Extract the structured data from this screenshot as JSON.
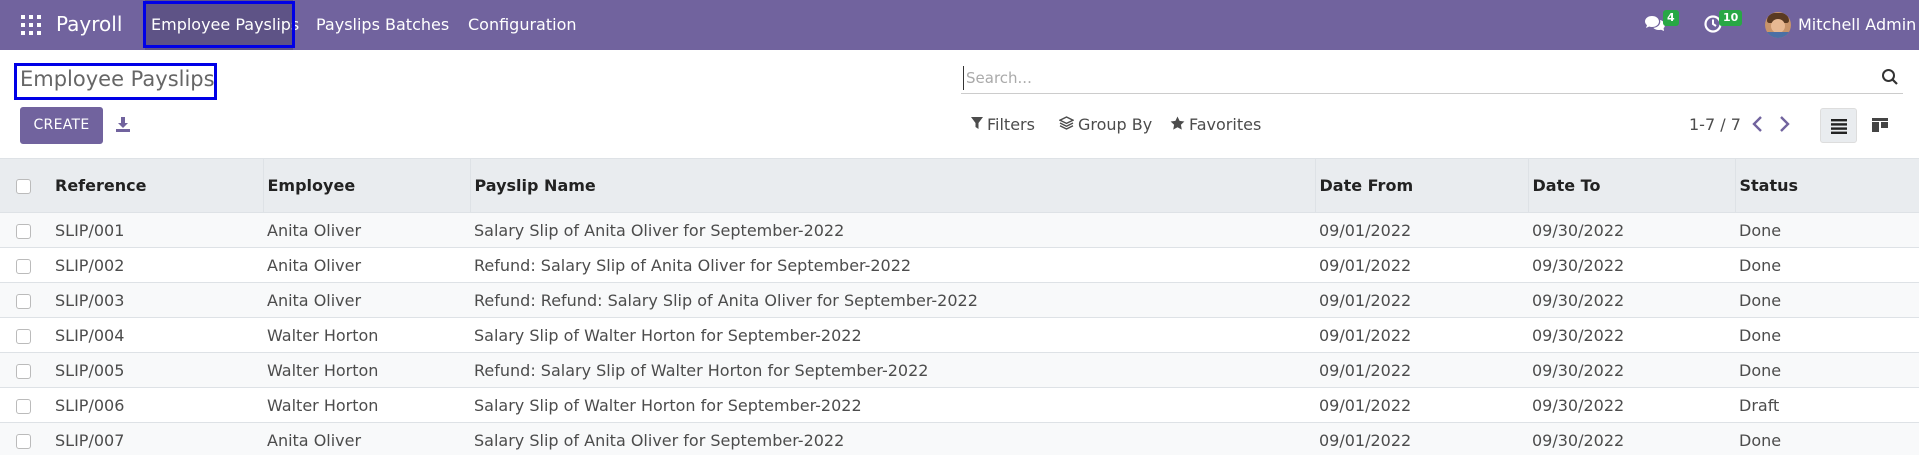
{
  "navbar": {
    "app_name": "Payroll",
    "menu": [
      {
        "label": "Employee Payslips"
      },
      {
        "label": "Payslips Batches"
      },
      {
        "label": "Configuration"
      }
    ],
    "messages_count": "4",
    "activities_count": "10",
    "user_name": "Mitchell Admin",
    "bg_color": "#71639e"
  },
  "control_panel": {
    "title": "Employee Payslips",
    "create_label": "CREATE",
    "search_placeholder": "Search...",
    "filters_label": "Filters",
    "group_by_label": "Group By",
    "favorites_label": "Favorites",
    "pager": "1-7 / 7"
  },
  "table": {
    "columns": [
      "Reference",
      "Employee",
      "Payslip Name",
      "Date From",
      "Date To",
      "Status"
    ],
    "rows": [
      {
        "reference": "SLIP/001",
        "employee": "Anita Oliver",
        "name": "Salary Slip of Anita Oliver for September-2022",
        "date_from": "09/01/2022",
        "date_to": "09/30/2022",
        "status": "Done"
      },
      {
        "reference": "SLIP/002",
        "employee": "Anita Oliver",
        "name": "Refund: Salary Slip of Anita Oliver for September-2022",
        "date_from": "09/01/2022",
        "date_to": "09/30/2022",
        "status": "Done"
      },
      {
        "reference": "SLIP/003",
        "employee": "Anita Oliver",
        "name": "Refund: Refund: Salary Slip of Anita Oliver for September-2022",
        "date_from": "09/01/2022",
        "date_to": "09/30/2022",
        "status": "Done"
      },
      {
        "reference": "SLIP/004",
        "employee": "Walter Horton",
        "name": "Salary Slip of Walter Horton for September-2022",
        "date_from": "09/01/2022",
        "date_to": "09/30/2022",
        "status": "Done"
      },
      {
        "reference": "SLIP/005",
        "employee": "Walter Horton",
        "name": "Refund: Salary Slip of Walter Horton for September-2022",
        "date_from": "09/01/2022",
        "date_to": "09/30/2022",
        "status": "Done"
      },
      {
        "reference": "SLIP/006",
        "employee": "Walter Horton",
        "name": "Salary Slip of Walter Horton for September-2022",
        "date_from": "09/01/2022",
        "date_to": "09/30/2022",
        "status": "Draft"
      },
      {
        "reference": "SLIP/007",
        "employee": "Anita Oliver",
        "name": "Salary Slip of Anita Oliver for September-2022",
        "date_from": "09/01/2022",
        "date_to": "09/30/2022",
        "status": "Done"
      }
    ]
  },
  "icons": [
    "apps-grid-icon",
    "chat-icon",
    "clock-icon",
    "download-icon",
    "search-icon",
    "filter-icon",
    "layers-icon",
    "star-icon",
    "chevron-left-icon",
    "chevron-right-icon",
    "list-view-icon",
    "kanban-view-icon"
  ]
}
